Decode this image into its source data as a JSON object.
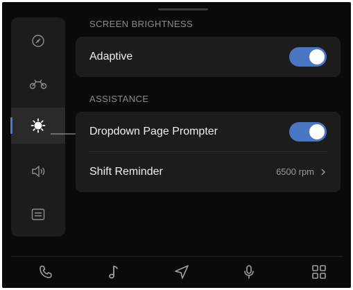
{
  "sections": [
    {
      "title": "SCREEN BRIGHTNESS",
      "rows": [
        {
          "label": "Adaptive",
          "toggle_on": true
        }
      ]
    },
    {
      "title": "ASSISTANCE",
      "rows": [
        {
          "label": "Dropdown Page Prompter",
          "toggle_on": true
        },
        {
          "label": "Shift Reminder",
          "value": "6500 rpm"
        }
      ]
    }
  ],
  "sidebar": {
    "items": [
      {
        "icon": "gauge-icon"
      },
      {
        "icon": "motorcycle-icon"
      },
      {
        "icon": "brightness-icon",
        "active": true
      },
      {
        "icon": "speaker-icon"
      },
      {
        "icon": "settings-panel-icon"
      }
    ]
  },
  "bottom_bar": {
    "items": [
      {
        "icon": "phone-icon"
      },
      {
        "icon": "music-note-icon"
      },
      {
        "icon": "navigation-icon"
      },
      {
        "icon": "microphone-icon"
      },
      {
        "icon": "apps-grid-icon"
      }
    ]
  },
  "colors": {
    "accent": "#4a76c4",
    "background": "#0a0a0a",
    "card": "#1c1c1c"
  }
}
